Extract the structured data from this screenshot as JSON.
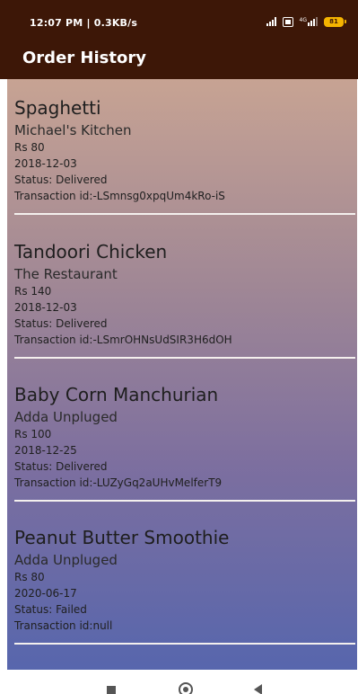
{
  "status_bar": {
    "time_text": "12:07 PM | 0.3KB/s",
    "network_label": "4G",
    "battery_level": "81",
    "icons": [
      "signal-icon",
      "volte-icon",
      "network-4g-icon",
      "battery-icon"
    ]
  },
  "app_bar": {
    "title": "Order History"
  },
  "orders": [
    {
      "name": "Spaghetti",
      "restaurant": "Michael's Kitchen",
      "price": "Rs 80",
      "date": "2018-12-03",
      "status": "Status: Delivered",
      "transaction": "Transaction id:-LSmnsg0xpqUm4kRo-iS"
    },
    {
      "name": "Tandoori Chicken",
      "restaurant": "The Restaurant",
      "price": "Rs 140",
      "date": "2018-12-03",
      "status": "Status: Delivered",
      "transaction": "Transaction id:-LSmrOHNsUdSIR3H6dOH"
    },
    {
      "name": "Baby Corn Manchurian",
      "restaurant": "Adda Unpluged",
      "price": "Rs 100",
      "date": "2018-12-25",
      "status": "Status: Delivered",
      "transaction": "Transaction id:-LUZyGq2aUHvMelferT9"
    },
    {
      "name": "Peanut Butter Smoothie",
      "restaurant": "Adda Unpluged",
      "price": "Rs 80",
      "date": "2020-06-17",
      "status": "Status: Failed",
      "transaction": "Transaction id:null"
    }
  ],
  "nav_bar": {
    "buttons": [
      "recents-button",
      "home-button",
      "back-button"
    ]
  },
  "colors": {
    "app_bar": "#3d1707",
    "gradient_top": "#c7a393",
    "gradient_bottom": "#5766ad",
    "battery": "#f5b400"
  }
}
